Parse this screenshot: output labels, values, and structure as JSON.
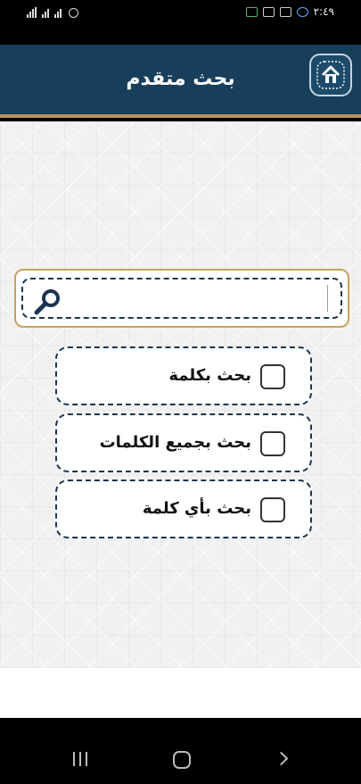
{
  "status_bar": {
    "time": "٢:٤٩",
    "icons": [
      "signal-icon",
      "signal-icon",
      "signal-icon",
      "alarm-icon",
      "quran-app-icon",
      "keyboard-icon",
      "gallery-icon",
      "vpn-icon"
    ]
  },
  "header": {
    "title": "بحث متقدم",
    "home_icon": "home-icon",
    "accent_color": "#b89256",
    "background_color": "#173e5b"
  },
  "search": {
    "value": "",
    "placeholder": "",
    "icon": "search-icon"
  },
  "options": [
    {
      "label": "بحث بكلمة",
      "checked": false
    },
    {
      "label": "بحث بجميع الكلمات",
      "checked": false
    },
    {
      "label": "بحث بأي كلمة",
      "checked": false
    }
  ],
  "nav_bar": {
    "icons": [
      "recent-apps-icon",
      "home-circle-icon",
      "back-icon"
    ]
  }
}
